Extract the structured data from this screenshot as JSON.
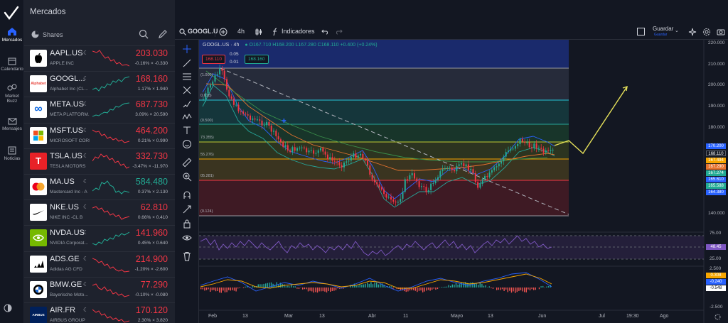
{
  "app": {
    "title": "Mercados"
  },
  "rail": {
    "items": [
      {
        "label": "Mercados",
        "icon": "home-icon",
        "active": true
      },
      {
        "label": "Calendario",
        "icon": "calendar-icon"
      },
      {
        "label": "Market Buzz",
        "icon": "market-buzz-icon"
      },
      {
        "label": "Mensajes",
        "icon": "mail-icon"
      },
      {
        "label": "Noticias",
        "icon": "news-icon"
      }
    ]
  },
  "watchlist": {
    "tab_label": "Shares",
    "items": [
      {
        "symbol": "AAPL.US",
        "name": "APPLE INC",
        "price": "203.030",
        "change": "-0.16% × -0.330",
        "dir": "neg",
        "logo_text": "",
        "logo_bg": "#ffffff",
        "logo_fg": "#000000"
      },
      {
        "symbol": "GOOGL...",
        "name": "Alphabet Inc (CL...",
        "price": "168.160",
        "change": "1.17% × 1.940",
        "dir": "neg",
        "logo_text": "Alphabet",
        "logo_bg": "#ffffff",
        "logo_fg": "#e8453c"
      },
      {
        "symbol": "META.US",
        "name": "META PLATFORM...",
        "price": "687.730",
        "change": "3.09% × 20.590",
        "dir": "neg",
        "logo_text": "∞",
        "logo_bg": "#ffffff",
        "logo_fg": "#0a66e1"
      },
      {
        "symbol": "MSFT.US",
        "name": "MICROSOFT CORP",
        "price": "464.200",
        "change": "0.21% × 0.990",
        "dir": "neg",
        "logo_text": "",
        "logo_bg": "#ffffff",
        "logo_fg": "#000000"
      },
      {
        "symbol": "TSLA.US",
        "name": "TESLA MOTORS",
        "price": "332.730",
        "change": "-3.47% × -11.970",
        "dir": "neg",
        "logo_text": "T",
        "logo_bg": "#e82127",
        "logo_fg": "#ffffff"
      },
      {
        "symbol": "MA.US",
        "name": "Mastercard Inc - A",
        "price": "584.480",
        "change": "0.37% × 2.130",
        "dir": "pos",
        "logo_text": "",
        "logo_bg": "#ffffff",
        "logo_fg": "#000000"
      },
      {
        "symbol": "NKE.US",
        "name": "NIKE INC -CL B",
        "price": "62.810",
        "change": "0.66% × 0.410",
        "dir": "neg",
        "logo_text": "✓",
        "logo_bg": "#ffffff",
        "logo_fg": "#000000"
      },
      {
        "symbol": "NVDA.US",
        "name": "NVIDIA Corporat...",
        "price": "141.960",
        "change": "0.45% × 0.640",
        "dir": "neg",
        "logo_text": "◉",
        "logo_bg": "#76b900",
        "logo_fg": "#ffffff"
      },
      {
        "symbol": "ADS.GE",
        "name": "Adidas AG CFD",
        "price": "214.900",
        "change": "-1.20% × -2.600",
        "dir": "neg",
        "logo_text": "▲",
        "logo_bg": "#ffffff",
        "logo_fg": "#000000"
      },
      {
        "symbol": "BMW.GE",
        "name": "Bayerische Moto...",
        "price": "77.290",
        "change": "-0.10% × -0.080",
        "dir": "neg",
        "logo_text": "◐",
        "logo_bg": "#ffffff",
        "logo_fg": "#1c69d4"
      },
      {
        "symbol": "AIR.FR",
        "name": "AIRBUS GROUP",
        "price": "170.120",
        "change": "2.30% × 3.820",
        "dir": "neg",
        "logo_text": "AIRBUS",
        "logo_bg": "#00205b",
        "logo_fg": "#ffffff"
      }
    ]
  },
  "toolbar": {
    "symbol": "GOOGL.U",
    "interval": "4h",
    "indicators_label": "Indicadores",
    "save_label": "Guardar",
    "save_sub": "Guardar"
  },
  "chart_header": {
    "title": "GOOGL.US · 4h",
    "o": "O167.710",
    "h": "H168.200",
    "l": "L167.280",
    "c": "C168.110",
    "change": "+0.400 (+0.24%)",
    "sell_price": "168.110",
    "spread": "0.05",
    "lot": "0.01",
    "buy_price": "168.160"
  },
  "fib_labels": [
    "(1.000)",
    "0.618)",
    "(0.500)",
    "73.355)",
    "55.276)",
    "05.281)",
    "(0.124)"
  ],
  "price_axis": [
    "220.000",
    "210.000",
    "200.000",
    "190.000",
    "180.000",
    "170.000",
    "160.000",
    "150.000",
    "140.000"
  ],
  "price_tags": [
    {
      "text": "170.200",
      "color": "#2962ff"
    },
    {
      "text": "168.110",
      "color": "#131722"
    },
    {
      "text": "167.494",
      "color": "#f7a600"
    },
    {
      "text": "167.290",
      "color": "#e6732e"
    },
    {
      "text": "167.274",
      "color": "#22ab94"
    },
    {
      "text": "165.610",
      "color": "#2962ff"
    },
    {
      "text": "165.588",
      "color": "#22ab94"
    },
    {
      "text": "164.380",
      "color": "#2962ff"
    }
  ],
  "rsi_axis": [
    "75.00",
    "50.00",
    "25.00"
  ],
  "rsi_value": "48.45",
  "macd_axis": [
    "2.500",
    "0.000",
    "-2.500"
  ],
  "macd_values": [
    {
      "text": "0.308",
      "color": "#f7a600"
    },
    {
      "text": "-0.240",
      "color": "#2962ff"
    },
    {
      "text": "-0.548",
      "color": "#ffffff"
    }
  ],
  "time_axis": [
    "Feb",
    "13",
    "Mar",
    "13",
    "Abr",
    "11",
    "Mayo",
    "13",
    "Jun",
    "Jul",
    "19:30",
    "Ago"
  ],
  "colors": {
    "up": "#22ab94",
    "down": "#f23645",
    "projection": "#e5e05a",
    "rsi_line": "#7e57c2"
  }
}
